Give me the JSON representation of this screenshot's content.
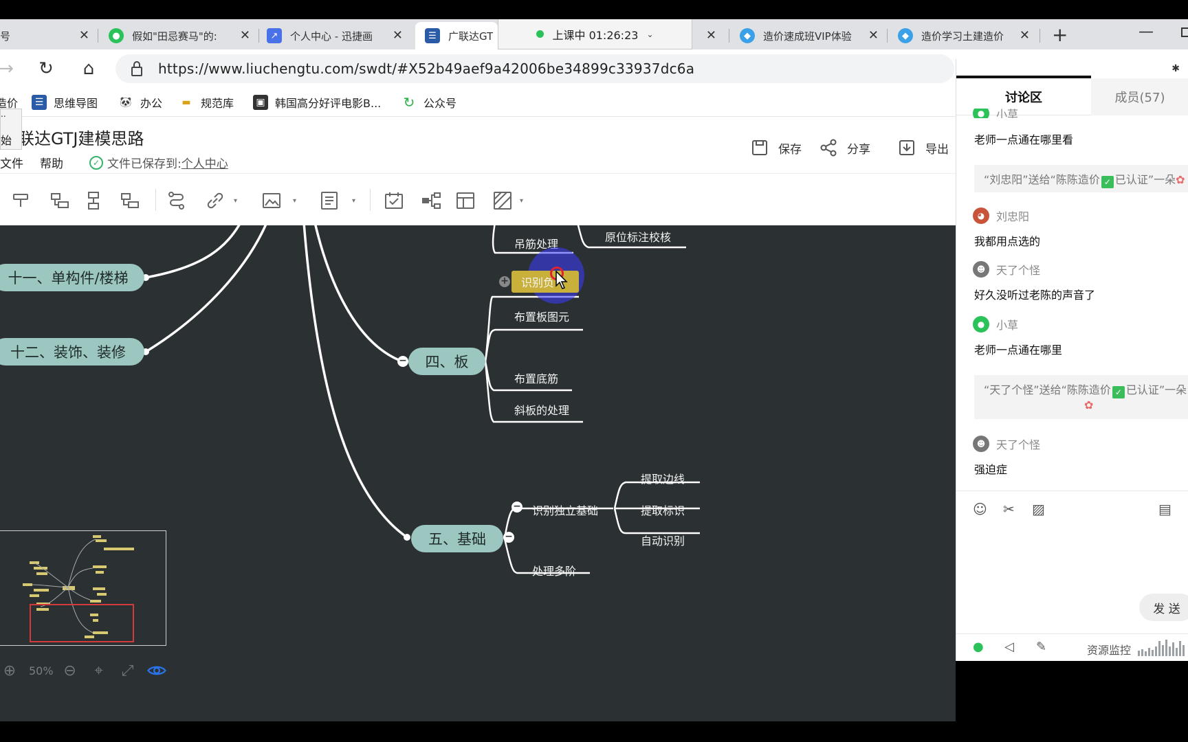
{
  "tabs": [
    {
      "title": "号",
      "favicon": "page-icon"
    },
    {
      "title": "假如\"田忌赛马\"的:",
      "favicon": "wechat-icon"
    },
    {
      "title": "个人中心 - 迅捷画",
      "favicon": "chart-icon"
    },
    {
      "title": "广联达GT",
      "favicon": "mindmap-icon"
    },
    {
      "title": "造价速成班VIP体验",
      "favicon": "shield-icon"
    },
    {
      "title": "造价学习土建造价",
      "favicon": "shield-icon"
    }
  ],
  "live_pill": {
    "label": "上课中 01:26:23"
  },
  "address": {
    "url": "https://www.liuchengtu.com/swdt/#X52b49aef9a42006be34899c33937dc6a"
  },
  "bookmarks": [
    {
      "label": "造价",
      "icon": "page-icon"
    },
    {
      "label": "思维导图",
      "icon": "mindmap-icon"
    },
    {
      "label": "办公",
      "icon": "panda-icon"
    },
    {
      "label": "规范库",
      "icon": "ruler-icon"
    },
    {
      "label": "韩国高分好评电影B...",
      "icon": "film-icon"
    },
    {
      "label": "公众号",
      "icon": "refresh-icon"
    }
  ],
  "left_float": {
    "line1": "..",
    "line2": "始"
  },
  "app": {
    "title": "联达GTJ建模思路",
    "menu": {
      "file": "文件",
      "help": "帮助"
    },
    "saved_prefix": "文件已保存到:",
    "saved_link": "个人中心",
    "save_label": "保存",
    "share_label": "分享",
    "export_label": "导出"
  },
  "mindmap": {
    "main_nodes": {
      "n11": "十一、单构件/楼梯",
      "n12": "十二、装饰、装修",
      "n4": "四、板",
      "n5": "五、基础"
    },
    "sub_nodes": {
      "diaojin": "吊筋处理",
      "yuanwei": "原位标注校核",
      "shibie_ban": "识别负",
      "buzhi_ban": "布置板图元",
      "buzhi_dijin": "布置底筋",
      "xieban": "斜板的处理",
      "shibie_duli": "识别独立基础",
      "tiqu_bianxian": "提取边线",
      "tiqu_biaoshi": "提取标识",
      "zidong": "自动识别",
      "duojie": "处理多阶"
    },
    "zoom": "50%"
  },
  "chat": {
    "tab_discussion": "讨论区",
    "tab_members": "成员(57)",
    "messages": [
      {
        "name": "小草",
        "text": "老师一点通在哪里看"
      },
      {
        "name": "刘忠阳",
        "text": "我都用点选的"
      },
      {
        "name": "天了个怪",
        "text": "好久没听过老陈的声音了"
      },
      {
        "name": "小草",
        "text": "老师一点通在哪里"
      },
      {
        "name": "天了个怪",
        "text": "强迫症"
      }
    ],
    "gift1": {
      "pre": "“刘忠阳”送给“陈陈造价",
      "post": "已认证”一朵"
    },
    "gift2": {
      "pre": "“天了个怪”送给“陈陈造价",
      "post": "已认证”一朵"
    },
    "send_label": "发 送",
    "resource_label": "资源监控"
  },
  "colors": {
    "canvas_bg": "#2b3033",
    "node_fill": "#9cc6c0",
    "link": "#ffffff",
    "selected_node": "#c9b03a",
    "cursor_highlight": "#3c3cff"
  }
}
